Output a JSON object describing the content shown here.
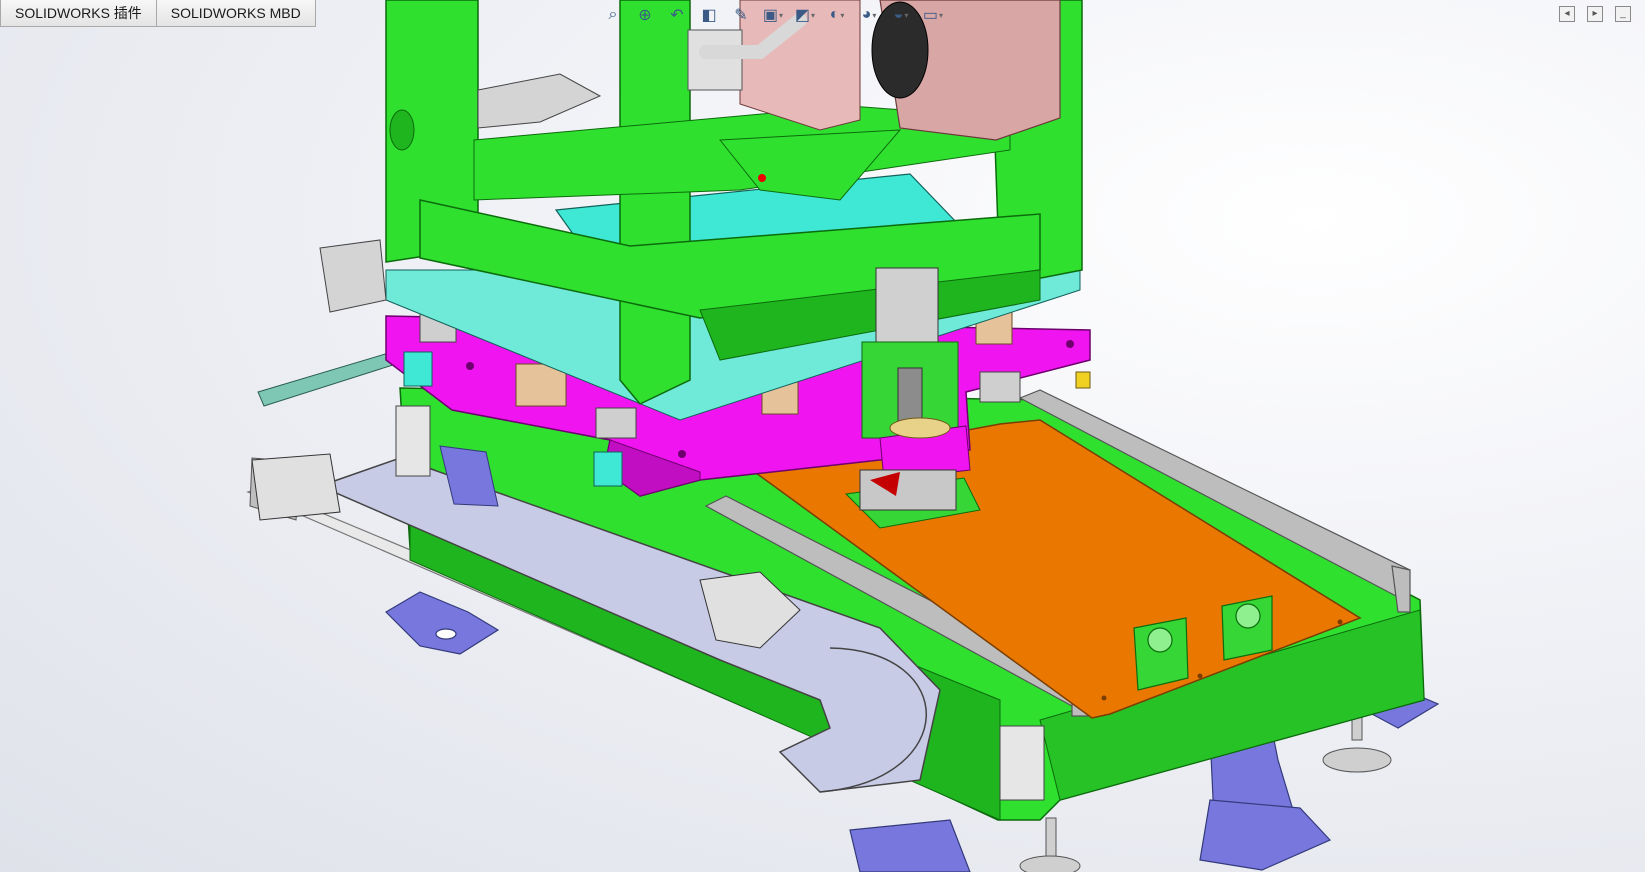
{
  "tabs": [
    {
      "label": "SOLIDWORKS 插件"
    },
    {
      "label": "SOLIDWORKS MBD"
    }
  ],
  "heads_up_toolbar": [
    {
      "icon": "zoom-to-fit-icon"
    },
    {
      "icon": "zoom-area-icon"
    },
    {
      "icon": "previous-view-icon"
    },
    {
      "icon": "section-view-icon"
    },
    {
      "icon": "dynamic-annotation-icon"
    },
    {
      "icon": "view-orientation-icon"
    },
    {
      "icon": "display-style-icon"
    },
    {
      "icon": "hide-show-items-icon"
    },
    {
      "icon": "edit-appearance-icon"
    },
    {
      "icon": "apply-scene-icon"
    },
    {
      "icon": "view-settings-icon"
    }
  ],
  "window_controls": [
    {
      "icon": "restore-view-left-icon"
    },
    {
      "icon": "restore-view-right-icon"
    },
    {
      "icon": "minimize-icon"
    }
  ],
  "colors": {
    "frame_green": "#2fe02f",
    "frame_green_dark": "#1a9e1a",
    "plate_magenta": "#f014f0",
    "plate_orange": "#ea7800",
    "plate_cyan": "#3fe8d5",
    "rail_gray": "#b9b9b9",
    "foot_blue": "#7777dd",
    "cable_chain": "#c8cbe6",
    "motor_pink": "#d9a6a6",
    "background": "#eef0f5"
  }
}
